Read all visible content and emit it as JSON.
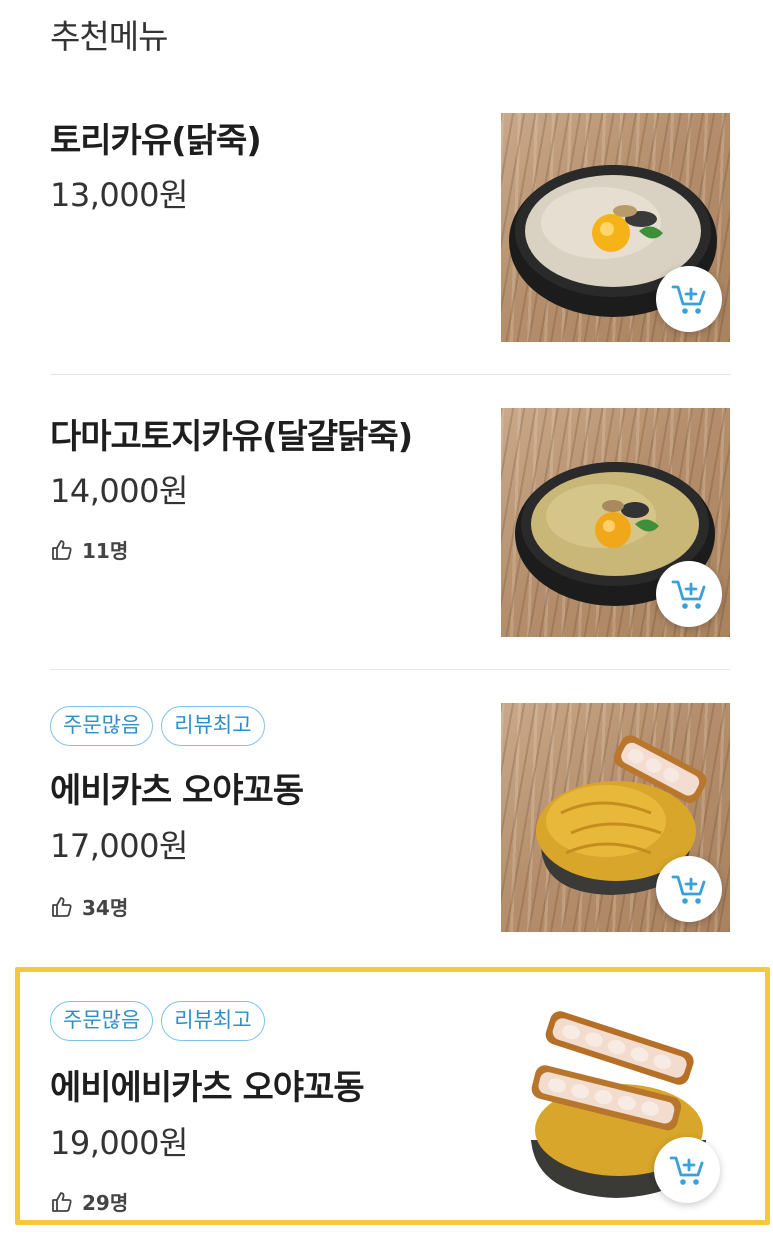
{
  "section": {
    "title": "추천메뉴"
  },
  "items": [
    {
      "name": "토리카유(닭죽)",
      "price": "13,000원",
      "likes": "",
      "badges": [],
      "image_icon": "chicken-porridge-photo",
      "cart_icon": "cart-add-icon"
    },
    {
      "name": "다마고토지카유(달걀닭죽)",
      "price": "14,000원",
      "likes": "11명",
      "badges": [],
      "image_icon": "egg-chicken-porridge-photo",
      "cart_icon": "cart-add-icon"
    },
    {
      "name": "에비카츠 오야꼬동",
      "price": "17,000원",
      "likes": "34명",
      "badges": [
        "주문많음",
        "리뷰최고"
      ],
      "image_icon": "shrimp-katsu-oyakodon-photo",
      "cart_icon": "cart-add-icon"
    },
    {
      "name": "에비에비카츠 오야꼬동",
      "price": "19,000원",
      "likes": "29명",
      "badges": [
        "주문많음",
        "리뷰최고"
      ],
      "image_icon": "double-shrimp-katsu-oyakodon-photo",
      "cart_icon": "cart-add-icon"
    }
  ],
  "colors": {
    "badge_border": "#7fc3e6",
    "badge_text": "#2e8fc4",
    "cart_icon": "#3aa0d8",
    "highlight_border": "#f5c73d"
  }
}
